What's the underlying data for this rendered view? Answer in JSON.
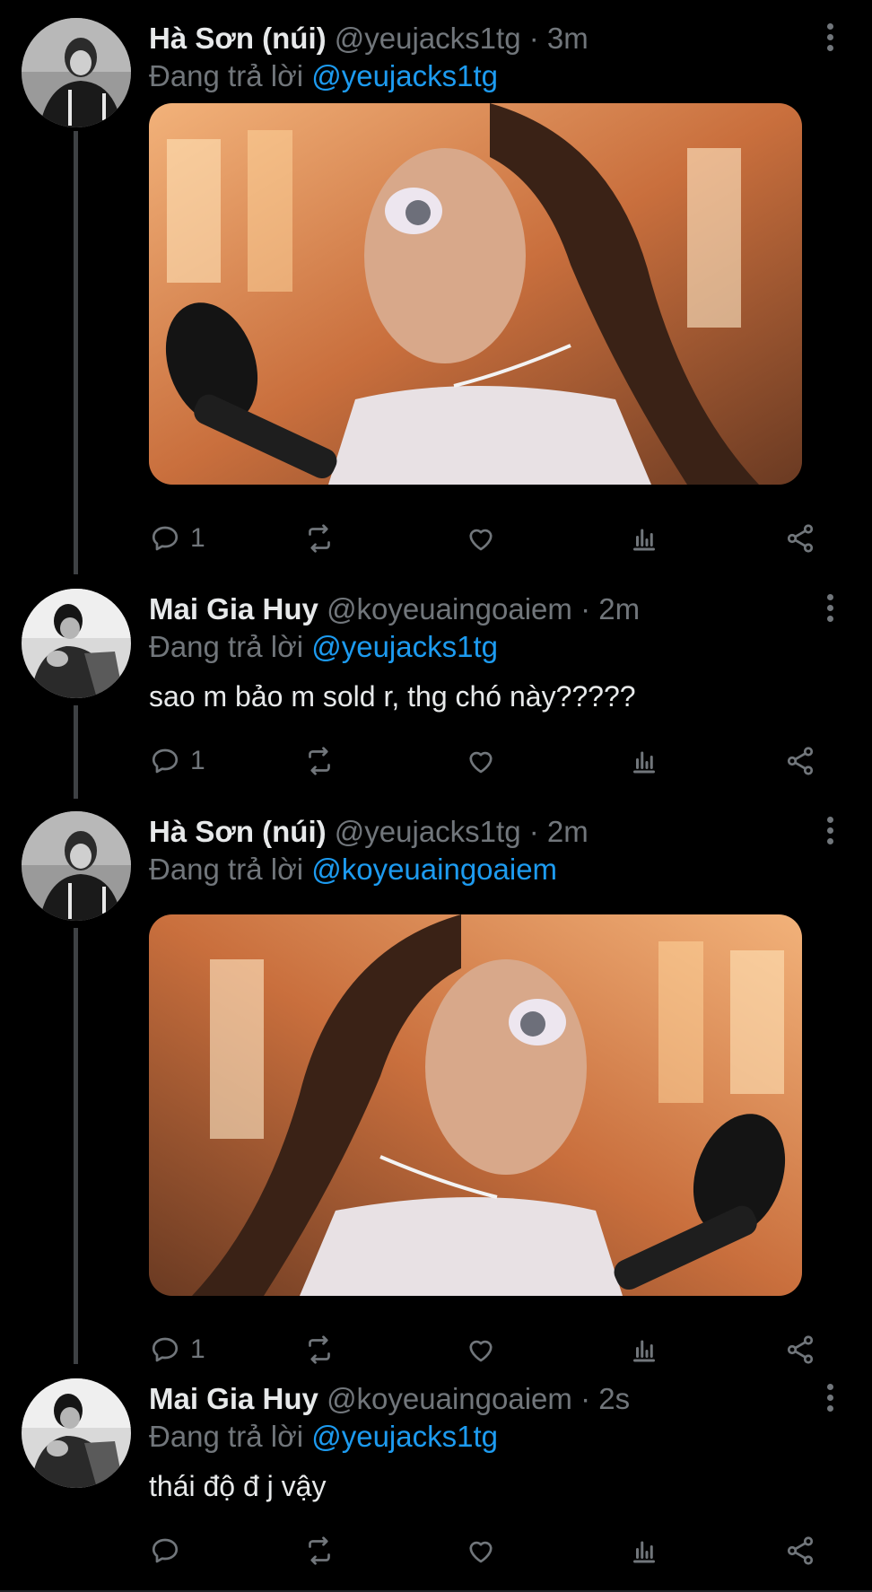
{
  "tweets": [
    {
      "name": "Hà Sơn (núi)",
      "handle": "@yeujacks1tg",
      "dot": "·",
      "time": "3m",
      "reply_prefix": "Đang trả lời",
      "reply_to": "@yeujacks1tg",
      "text": "",
      "has_media": true,
      "media_description_icon": "photo",
      "reply_count": "1",
      "retweet_count": "",
      "like_count": ""
    },
    {
      "name": "Mai Gia Huy",
      "handle": "@koyeuaingoaiem",
      "dot": "·",
      "time": "2m",
      "reply_prefix": "Đang trả lời",
      "reply_to": "@yeujacks1tg",
      "text": "sao m bảo m sold r, thg chó này?????",
      "has_media": false,
      "reply_count": "1",
      "retweet_count": "",
      "like_count": ""
    },
    {
      "name": "Hà Sơn (núi)",
      "handle": "@yeujacks1tg",
      "dot": "·",
      "time": "2m",
      "reply_prefix": "Đang trả lời",
      "reply_to": "@koyeuaingoaiem",
      "text": "",
      "has_media": true,
      "media_description_icon": "photo",
      "reply_count": "1",
      "retweet_count": "",
      "like_count": ""
    },
    {
      "name": "Mai Gia Huy",
      "handle": "@koyeuaingoaiem",
      "dot": "·",
      "time": "2s",
      "reply_prefix": "Đang trả lời",
      "reply_to": "@yeujacks1tg",
      "text": "thái độ đ j vậy",
      "has_media": false,
      "reply_count": "",
      "retweet_count": "",
      "like_count": ""
    }
  ],
  "icons": {
    "reply": "reply-icon",
    "retweet": "retweet-icon",
    "like": "heart-icon",
    "analytics": "analytics-icon",
    "share": "share-icon",
    "more": "more-vertical-icon"
  },
  "colors": {
    "background": "#000000",
    "name": "#e7e9ea",
    "secondary": "#71767b",
    "mention": "#1d9bf0",
    "thread_line": "#3e4144"
  }
}
